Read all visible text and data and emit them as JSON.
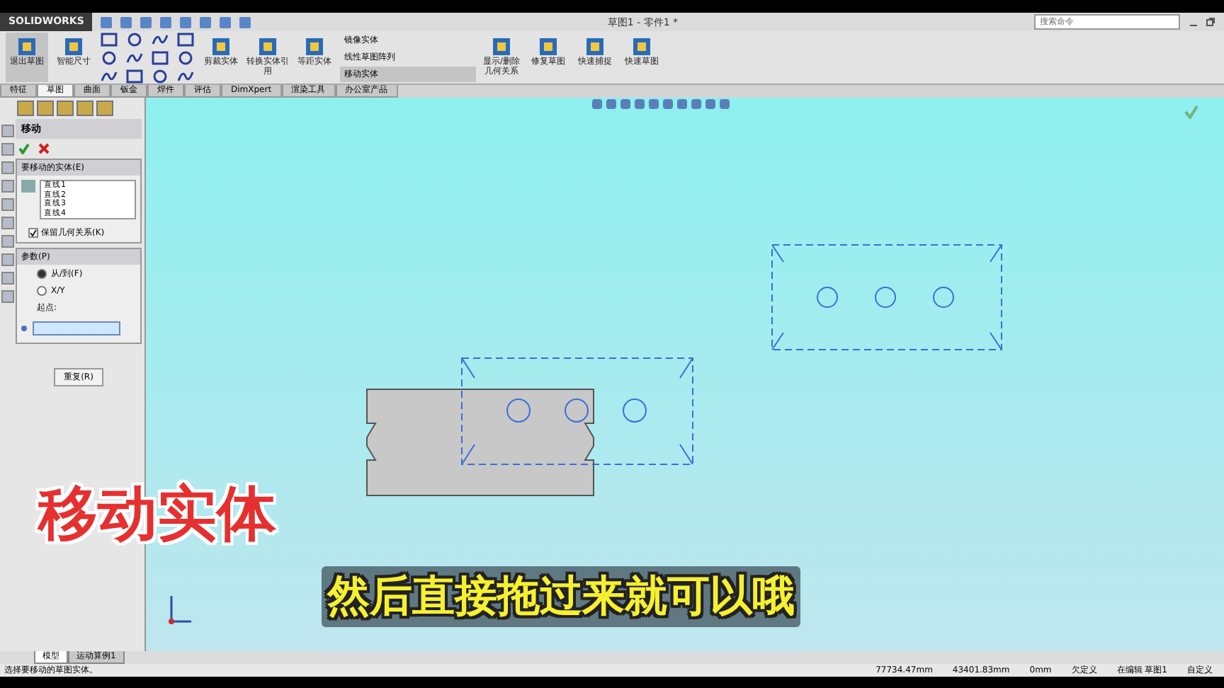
{
  "app": {
    "logo": "SOLIDWORKS",
    "title": "草图1 - 零件1 *",
    "search": {
      "placeholder": "搜索命令"
    }
  },
  "ribbon": [
    {
      "label": "退出草图",
      "kind": "large",
      "selected": true
    },
    {
      "label": "智能尺寸",
      "kind": "large",
      "selected": false
    },
    {
      "kind": "tools"
    },
    {
      "label": "剪裁实体",
      "kind": "large",
      "selected": false
    },
    {
      "label": "转换实体引用",
      "kind": "large",
      "selected": false
    },
    {
      "label": "等距实体",
      "kind": "large",
      "selected": false
    },
    {
      "kind": "stack",
      "items": [
        {
          "label": "镜像实体",
          "selected": false
        },
        {
          "label": "线性草图阵列",
          "selected": false
        },
        {
          "label": "移动实体",
          "selected": true
        }
      ]
    },
    {
      "label": "显示/删除几何关系",
      "kind": "large",
      "selected": false
    },
    {
      "label": "修复草图",
      "kind": "large",
      "selected": false
    },
    {
      "label": "快速捕捉",
      "kind": "large",
      "selected": false
    },
    {
      "label": "快速草图",
      "kind": "large",
      "selected": false
    }
  ],
  "tabs": [
    {
      "label": "特征",
      "selected": false
    },
    {
      "label": "草图",
      "selected": true
    },
    {
      "label": "曲面",
      "selected": false
    },
    {
      "label": "钣金",
      "selected": false
    },
    {
      "label": "焊件",
      "selected": false
    },
    {
      "label": "评估",
      "selected": false
    },
    {
      "label": "DimXpert",
      "selected": false
    },
    {
      "label": "渲染工具",
      "selected": false
    },
    {
      "label": "办公室产品",
      "selected": false
    }
  ],
  "panel": {
    "title": "移动",
    "entities": {
      "title": "要移动的实体(E)",
      "items": [
        "直线1",
        "直线2",
        "直线3",
        "直线4"
      ],
      "keep_relations": {
        "label": "保留几何关系(K)",
        "checked": true
      }
    },
    "params": {
      "title": "参数(P)",
      "options": [
        {
          "label": "从/到(F)",
          "selected": true
        },
        {
          "label": "X/Y",
          "selected": false
        }
      ],
      "start_label": "起点:",
      "repeat_button": "重复(R)"
    }
  },
  "bottom_tabs": [
    {
      "label": "模型",
      "selected": true
    },
    {
      "label": "运动算例1",
      "selected": false
    }
  ],
  "status": {
    "message": "选择要移动的草图实体。",
    "x": "77734.47mm",
    "y": "43401.83mm",
    "z": "0mm",
    "state": "欠定义",
    "editing": "在编辑 草图1",
    "units": "自定义"
  },
  "captions": {
    "title": "移动实体",
    "subtitle": "然后直接拖过来就可以哦"
  }
}
